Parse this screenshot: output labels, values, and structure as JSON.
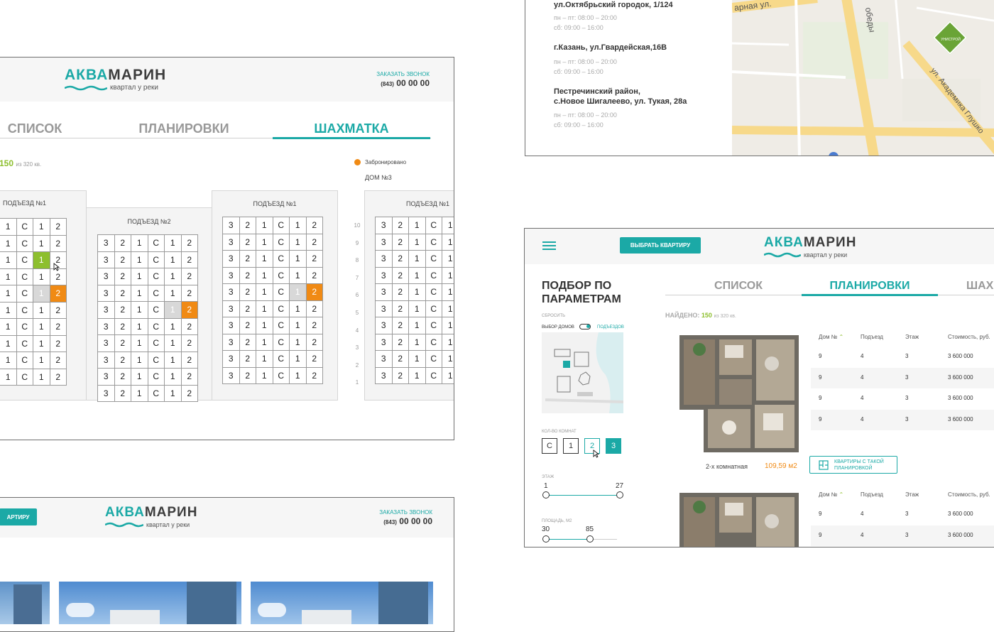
{
  "brand": {
    "word_part1": "АКВА",
    "word_part2": "МАРИН",
    "tagline": "квартал у реки"
  },
  "header": {
    "order_label": "ЗАКАЗАТЬ ЗВОНОК",
    "phone_code": "(843)",
    "phone": "00 00 00",
    "choose_button": "ВЫБРАТЬ КВАРТИРУ",
    "choose_button_cut": "АРТИРУ"
  },
  "chess": {
    "tabs": [
      "СПИСОК",
      "ПЛАНИРОВКИ",
      "ШАХМАТКА"
    ],
    "active_tab": "ШАХМАТКА",
    "found_count": "150",
    "found_total": "из 320 кв.",
    "legend_booked": "Забронировано",
    "house_label": "ДОМ №3",
    "entrances": [
      "ПОДЪЕЗД №1",
      "ПОДЪЕЗД №2",
      "ПОДЪЕЗД №1",
      "ПОДЪЕЗД №1"
    ],
    "floors": [
      "10",
      "9",
      "8",
      "7",
      "6",
      "5",
      "4",
      "3",
      "2",
      "1"
    ],
    "row_values": [
      "3",
      "2",
      "1",
      "С",
      "1",
      "2"
    ],
    "selected_cell": {
      "floor": "8",
      "label": "1"
    },
    "colors": {
      "booked": "#f08a14",
      "selected": "#8dbf2e",
      "sold": "#d8d8d8",
      "accent": "#1ba9a6"
    }
  },
  "contacts": [
    {
      "address": "ул.Октябрьский городок, 1/124",
      "hours1": "пн – пт: 08:00 – 20:00",
      "hours2": "сб: 09:00 – 16:00"
    },
    {
      "address": "г.Казань, ул.Гвардейская,16В",
      "hours1": "пн – пт: 08:00 – 20:00",
      "hours2": "сб: 09:00 – 16:00"
    },
    {
      "address_line1": "Пестречинский район,",
      "address_line2": "с.Новое Шигалеево, ул. Тукая, 28а",
      "hours1": "пн – пт: 08:00 – 20:00",
      "hours2": "сб: 09:00 – 16:00"
    }
  ],
  "map": {
    "street1": "арная ул.",
    "street2": "обеды",
    "street3": "ул. Академика Глушко",
    "pin_label": "УНИСТРОЙ"
  },
  "filter": {
    "title_line1": "ПОДБОР ПО",
    "title_line2": "ПАРАМЕТРАМ",
    "reset": "СБРОСИТЬ",
    "houses_label": "ВЫБОР ДОМОВ",
    "entrances_label": "ПОДЪЕЗДОВ",
    "rooms_label": "КОЛ-ВО КОМНАТ",
    "room_options": [
      "С",
      "1",
      "2",
      "3"
    ],
    "selected_rooms": [
      "2",
      "3"
    ],
    "floor_label": "ЭТАЖ",
    "floor_min": "1",
    "floor_max": "27",
    "area_label": "ПЛОЩАДЬ, М2",
    "area_min": "30",
    "area_max": "85",
    "tabs": [
      "СПИСОК",
      "ПЛАНИРОВКИ",
      "ШАХ"
    ],
    "active_tab": "ПЛАНИРОВКИ",
    "found_label": "НАЙДЕНО:",
    "found_count": "150",
    "found_total": "из 320 кв."
  },
  "table": {
    "headers": [
      "Дом №",
      "Подъезд",
      "Этаж",
      "Стоимость, руб."
    ],
    "rows": [
      [
        "9",
        "4",
        "3",
        "3 600 000"
      ],
      [
        "9",
        "4",
        "3",
        "3 600 000"
      ],
      [
        "9",
        "4",
        "3",
        "3 600 000"
      ],
      [
        "9",
        "4",
        "3",
        "3 600 000"
      ]
    ],
    "rows2": [
      [
        "9",
        "4",
        "3",
        "3 600 000"
      ],
      [
        "9",
        "4",
        "3",
        "3 600 000"
      ]
    ]
  },
  "plan": {
    "type_label": "2-х комнатная",
    "area": "109,59 м2",
    "same_layout_button_line1": "КВАРТИРЫ С ТАКОЙ",
    "same_layout_button_line2": "ПЛАНИРОВКОЙ"
  }
}
